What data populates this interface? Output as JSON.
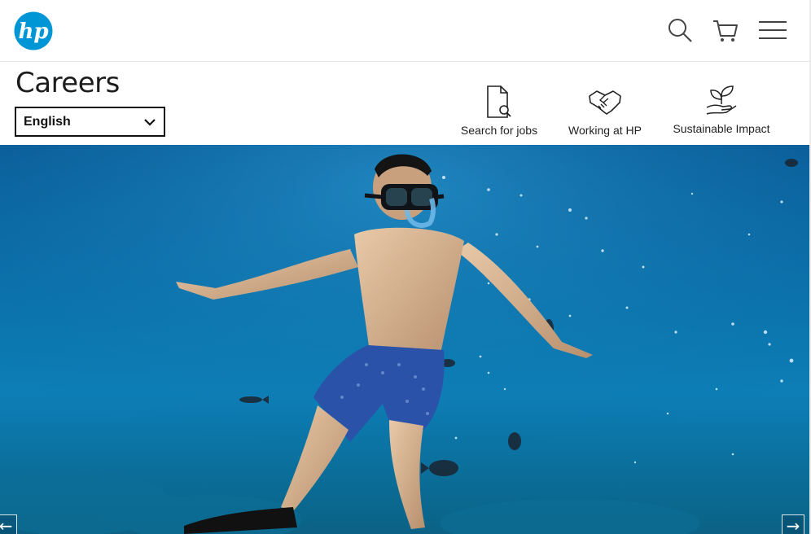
{
  "header": {
    "logo_text": "hp",
    "icons": [
      "search-icon",
      "cart-icon",
      "menu-icon"
    ],
    "brand_color": "#0096d6"
  },
  "careers": {
    "title": "Careers",
    "language_select": {
      "value": "English"
    }
  },
  "quick_links": [
    {
      "label": "Search for jobs",
      "icon": "document-search-icon"
    },
    {
      "label": "Working at HP",
      "icon": "handshake-icon"
    },
    {
      "label": "Sustainable Impact",
      "icon": "plant-hand-icon"
    }
  ],
  "hero": {
    "image": "underwater-snorkeler",
    "prev_arrow": "←",
    "next_arrow": "→",
    "water_color": "#0b6fa8"
  }
}
